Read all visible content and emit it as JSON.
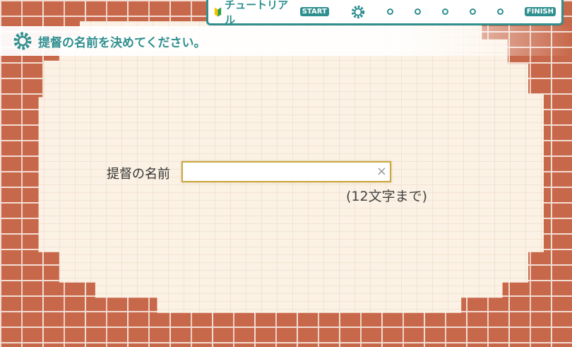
{
  "tutorial": {
    "title": "チュートリアル",
    "start_label": "START",
    "finish_label": "FINISH"
  },
  "header": {
    "text": "提督の名前を決めてください。"
  },
  "form": {
    "label": "提督の名前",
    "value": "",
    "clear": "×",
    "hint": "(12文字まで)"
  },
  "colors": {
    "accent": "#2f8f8f",
    "brick": "#c8684a",
    "wall": "#fbf1e4",
    "input_border": "#c9a93f"
  }
}
